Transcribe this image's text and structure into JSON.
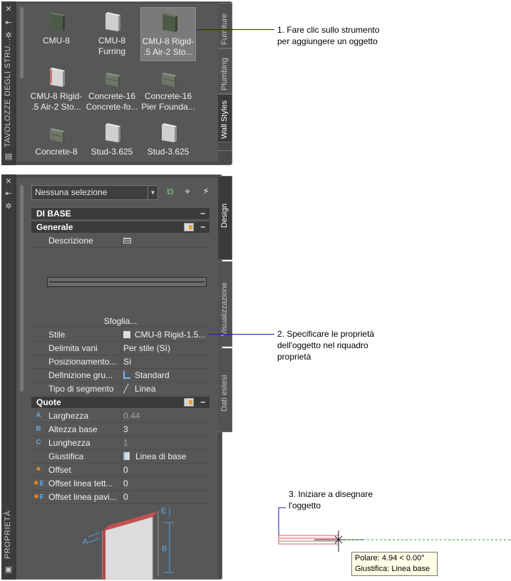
{
  "tool_palette": {
    "title": "TAVOLOZZE DEGLI STRU...",
    "tools": [
      {
        "label_line1": "CMU-8",
        "label_line2": ""
      },
      {
        "label_line1": "CMU-8",
        "label_line2": "Furring"
      },
      {
        "label_line1": "CMU-8 Rigid-",
        "label_line2": ".5 Air-2 Sto..."
      },
      {
        "label_line1": "CMU-8 Rigid-",
        "label_line2": ".5 Air-2 Sto..."
      },
      {
        "label_line1": "Concrete-16",
        "label_line2": "Concrete-fo..."
      },
      {
        "label_line1": "Concrete-16",
        "label_line2": "Pier Founda..."
      },
      {
        "label_line1": "Concrete-8",
        "label_line2": ""
      },
      {
        "label_line1": "Stud-3.625",
        "label_line2": ""
      },
      {
        "label_line1": "Stud-3.625",
        "label_line2": ""
      }
    ],
    "tabs": [
      "Furniture",
      "Plumbing",
      "Wall Styles"
    ]
  },
  "properties": {
    "title": "PROPRIETÀ",
    "selection": "Nessuna selezione",
    "tabs": [
      "Design",
      "Visualizzazione",
      "Dati estesi"
    ],
    "section_base": "DI BASE",
    "section_generale": "Generale",
    "descrizione_label": "Descrizione",
    "browse_label": "Sfoglia...",
    "generale_rows": [
      {
        "key": "Stile",
        "value": "CMU-8 Rigid-1.5..."
      },
      {
        "key": "Delimita vani",
        "value": "Per stile (Sì)"
      },
      {
        "key": "Posizionamento...",
        "value": "Sì"
      },
      {
        "key": "Definizione  gru...",
        "value": "Standard"
      },
      {
        "key": "Tipo di segmento",
        "value": "Linea"
      }
    ],
    "section_quote": "Quote",
    "quote_rows": [
      {
        "letter": "A",
        "key": "Larghezza",
        "value": "0.44"
      },
      {
        "letter": "B",
        "key": "Altezza base",
        "value": "3"
      },
      {
        "letter": "C",
        "key": "Lunghezza",
        "value": "1"
      },
      {
        "letter": "",
        "key": "Giustifica",
        "value": "Linea di base"
      },
      {
        "letter": "",
        "key": "Offset",
        "value": "0"
      },
      {
        "letter": "E",
        "key": "Offset linea tett...",
        "value": "0"
      },
      {
        "letter": "F",
        "key": "Offset linea pavi...",
        "value": "0"
      }
    ],
    "diagram_labels": {
      "a": "A",
      "b": "B",
      "e": "E"
    }
  },
  "callouts": {
    "c1_line1": "1. Fare clic sullo strumento",
    "c1_line2": "per aggiungere un oggetto",
    "c2_line1": "2. Specificare le proprietà",
    "c2_line2": "dell'oggetto nel riquadro",
    "c2_line3": "proprietà",
    "c3_line1": "3. Iniziare a disegnare",
    "c3_line2": "l'oggetto"
  },
  "tooltip": {
    "line1": "Polare: 4.94 < 0.00°",
    "line2": "Giustifica: Linea base"
  }
}
